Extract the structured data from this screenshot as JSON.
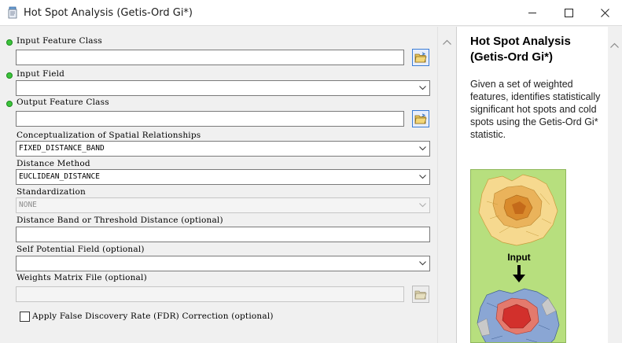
{
  "window": {
    "title": "Hot Spot Analysis (Getis-Ord Gi*)",
    "app_icon": "script-tool-icon",
    "controls": [
      "minimize-icon",
      "maximize-icon",
      "close-icon"
    ]
  },
  "form": {
    "input_feature_class": {
      "label": "Input Feature Class",
      "value": "",
      "required": true
    },
    "input_field": {
      "label": "Input Field",
      "value": "",
      "required": true
    },
    "output_feature_class": {
      "label": "Output Feature Class",
      "value": "",
      "required": true
    },
    "conceptualization": {
      "label": "Conceptualization of Spatial Relationships",
      "value": "FIXED_DISTANCE_BAND"
    },
    "distance_method": {
      "label": "Distance Method",
      "value": "EUCLIDEAN_DISTANCE"
    },
    "standardization": {
      "label": "Standardization",
      "value": "NONE",
      "disabled": true
    },
    "distance_band": {
      "label": "Distance Band or Threshold Distance (optional)",
      "value": ""
    },
    "self_potential": {
      "label": "Self Potential Field (optional)",
      "value": ""
    },
    "weights_matrix": {
      "label": "Weights Matrix File (optional)",
      "value": "",
      "disabled": true
    },
    "fdr": {
      "label": "Apply False Discovery Rate (FDR) Correction (optional)",
      "checked": false
    }
  },
  "help": {
    "title": "Hot Spot Analysis (Getis-Ord Gi*)",
    "body": "Given a set of weighted features, identifies statistically significant hot spots and cold spots using the Getis-Ord Gi* statistic.",
    "illustration_label": "Input"
  },
  "colors": {
    "required_dot": "#3cc43c",
    "illustration_bg": "#b7df7e",
    "hot": "#d2302c",
    "cold": "#5b7fb8"
  }
}
